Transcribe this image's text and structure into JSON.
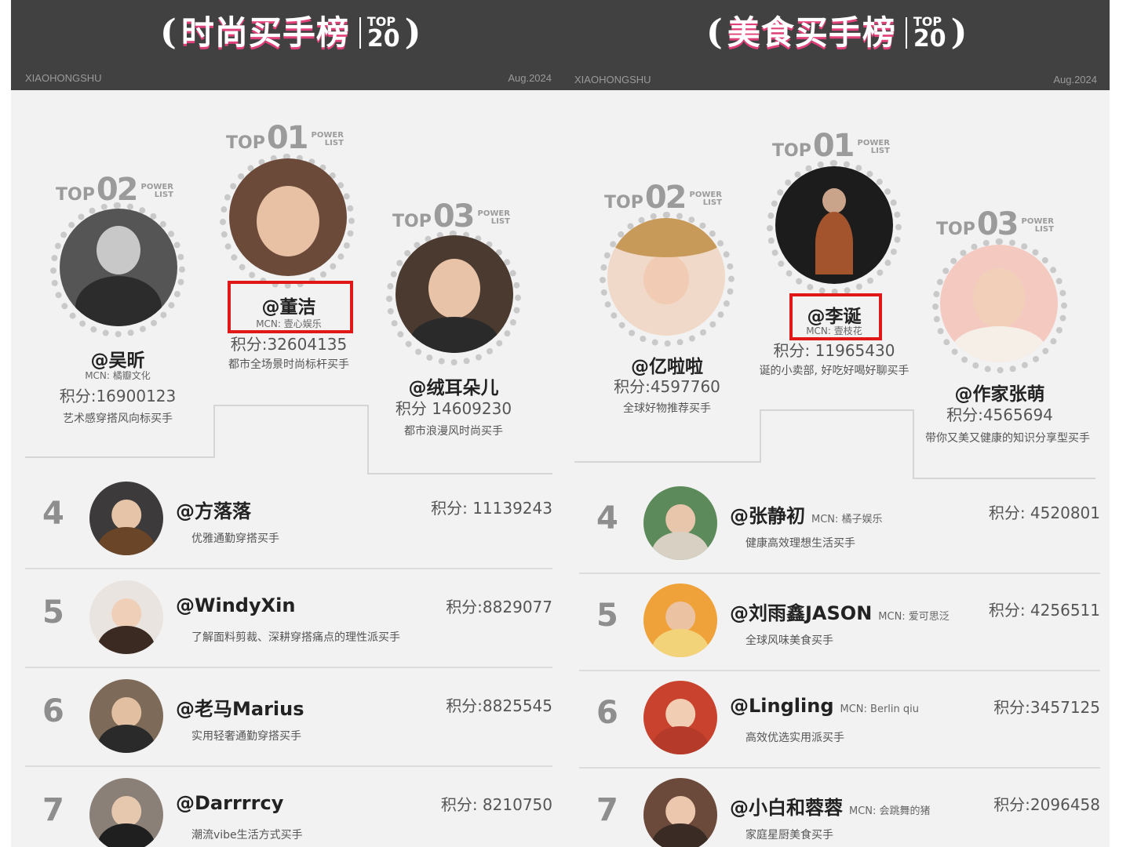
{
  "left": {
    "title": "时尚买手榜",
    "top20_a": "TOP",
    "top20_b": "20",
    "brand": "XIAOHONGSHU",
    "date": "Aug.2024",
    "podium": [
      {
        "top": "TOP",
        "num": "01",
        "power": "POWER",
        "list": "LIST",
        "name": "@董洁",
        "mcn": "MCN: 壹心娱乐",
        "score": "积分:32604135",
        "desc": "都市全场景时尚标杆买手"
      },
      {
        "top": "TOP",
        "num": "02",
        "power": "POWER",
        "list": "LIST",
        "name": "@吴昕",
        "mcn": "MCN: 橘瓣文化",
        "score": "积分:16900123",
        "desc": "艺术感穿搭风向标买手"
      },
      {
        "top": "TOP",
        "num": "03",
        "power": "POWER",
        "list": "LIST",
        "name": "@绒耳朵儿",
        "score": "积分 14609230",
        "desc": "都市浪漫风时尚买手"
      }
    ],
    "rows": [
      {
        "rank": "4",
        "name": "@方落落",
        "desc": "优雅通勤穿搭买手",
        "score": "积分: 11139243"
      },
      {
        "rank": "5",
        "name": "@WindyXin",
        "desc": "了解面料剪裁、深耕穿搭痛点的理性派买手",
        "score": "积分:8829077"
      },
      {
        "rank": "6",
        "name": "@老马Marius",
        "desc": "实用轻奢通勤穿搭买手",
        "score": "积分:8825545"
      },
      {
        "rank": "7",
        "name": "@Darrrrcy",
        "desc": "潮流vibe生活方式买手",
        "score": "积分: 8210750"
      }
    ]
  },
  "right": {
    "title": "美食买手榜",
    "top20_a": "TOP",
    "top20_b": "20",
    "brand": "XIAOHONGSHU",
    "date": "Aug.2024",
    "podium": [
      {
        "top": "TOP",
        "num": "01",
        "power": "POWER",
        "list": "LIST",
        "name": "@李诞",
        "mcn": "MCN: 壹枝花",
        "score": "积分: 11965430",
        "desc": "诞的小卖部, 好吃好喝好聊买手"
      },
      {
        "top": "TOP",
        "num": "02",
        "power": "POWER",
        "list": "LIST",
        "name": "@亿啦啦",
        "score": "积分:4597760",
        "desc": "全球好物推荐买手"
      },
      {
        "top": "TOP",
        "num": "03",
        "power": "POWER",
        "list": "LIST",
        "name": "@作家张萌",
        "score": "积分:4565694",
        "desc": "带你又美又健康的知识分享型买手"
      }
    ],
    "rows": [
      {
        "rank": "4",
        "name": "@张静初",
        "mcn": "MCN: 橘子娱乐",
        "desc": "健康高效理想生活买手",
        "score": "积分: 4520801"
      },
      {
        "rank": "5",
        "name": "@刘雨鑫JASON",
        "mcn": "MCN: 爱可思泛",
        "desc": "全球风味美食买手",
        "score": "积分: 4256511"
      },
      {
        "rank": "6",
        "name": "@Lingling",
        "mcn": "MCN: Berlin qiu",
        "desc": "高效优选实用派买手",
        "score": "积分:3457125"
      },
      {
        "rank": "7",
        "name": "@小白和蓉蓉",
        "mcn": "MCN: 会跳舞的猪",
        "desc": "家庭星厨美食买手",
        "score": "积分:2096458"
      }
    ]
  }
}
